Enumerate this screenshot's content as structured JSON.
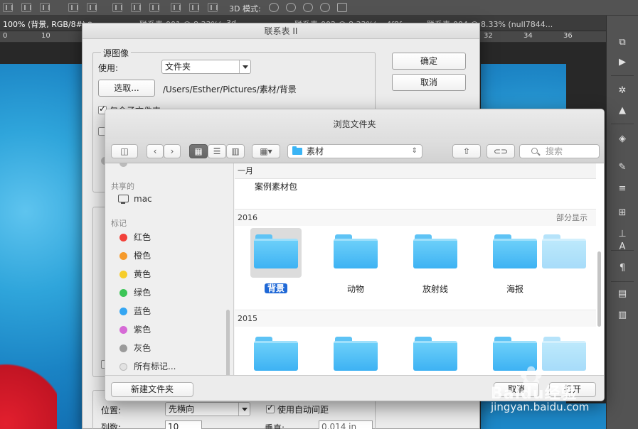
{
  "ps": {
    "mode_3d_label": "3D 模式:",
    "doc_tab_active": "100% (背景, RGB/8#) *",
    "doc_tab_2": "联系表-001 @ 8.33%(...",
    "doc_tab_3": "3d",
    "doc_tab_4": "联系表-002 @ 8.33%(... 4f8f...",
    "doc_tab_5": "联系表-004 @ 8.33% (null7844...",
    "ruler_numbers": [
      "0",
      "10",
      "32",
      "34",
      "36"
    ]
  },
  "contact_sheet": {
    "title": "联系表 II",
    "source_group_label": "源图像",
    "use_label": "使用:",
    "use_value": "文件夹",
    "choose_button": "选取...",
    "path": "/Users/Esther/Pictures/素材/背景",
    "include_subfolders": "包含子文件夹",
    "ok_button": "确定",
    "cancel_button": "取消",
    "position_label": "位置:",
    "position_value": "先横向",
    "auto_spacing_label": "使用自动间距",
    "columns_label": "列数:",
    "columns_value": "10",
    "vertical_label": "垂直:",
    "vertical_value": "0.014 in"
  },
  "browse": {
    "title": "浏览文件夹",
    "location": "素材",
    "search_placeholder": "搜索",
    "sidebar": {
      "shared_head": "共享的",
      "shared_items": [
        "mac"
      ],
      "tags_head": "标记",
      "tags": [
        {
          "label": "红色",
          "color": "#f2413a"
        },
        {
          "label": "橙色",
          "color": "#f59a2c"
        },
        {
          "label": "黄色",
          "color": "#f6cd2a"
        },
        {
          "label": "绿色",
          "color": "#3bc557"
        },
        {
          "label": "蓝色",
          "color": "#34a6f2"
        },
        {
          "label": "紫色",
          "color": "#d66ad6"
        },
        {
          "label": "灰色",
          "color": "#9b9b9b"
        }
      ],
      "all_tags": "所有标记..."
    },
    "sections": {
      "jan_head": "一月",
      "jan_item": "案例素材包",
      "y2016_head": "2016",
      "y2016_action": "部分显示",
      "y2016_folders": [
        "背景",
        "动物",
        "放射线",
        "海报"
      ],
      "y2015_head": "2015"
    },
    "new_folder_button": "新建文件夹",
    "cancel_button": "取消",
    "open_button": "打开"
  },
  "watermark": {
    "brand": "Baidu经验",
    "url": "jingyan.baidu.com"
  }
}
